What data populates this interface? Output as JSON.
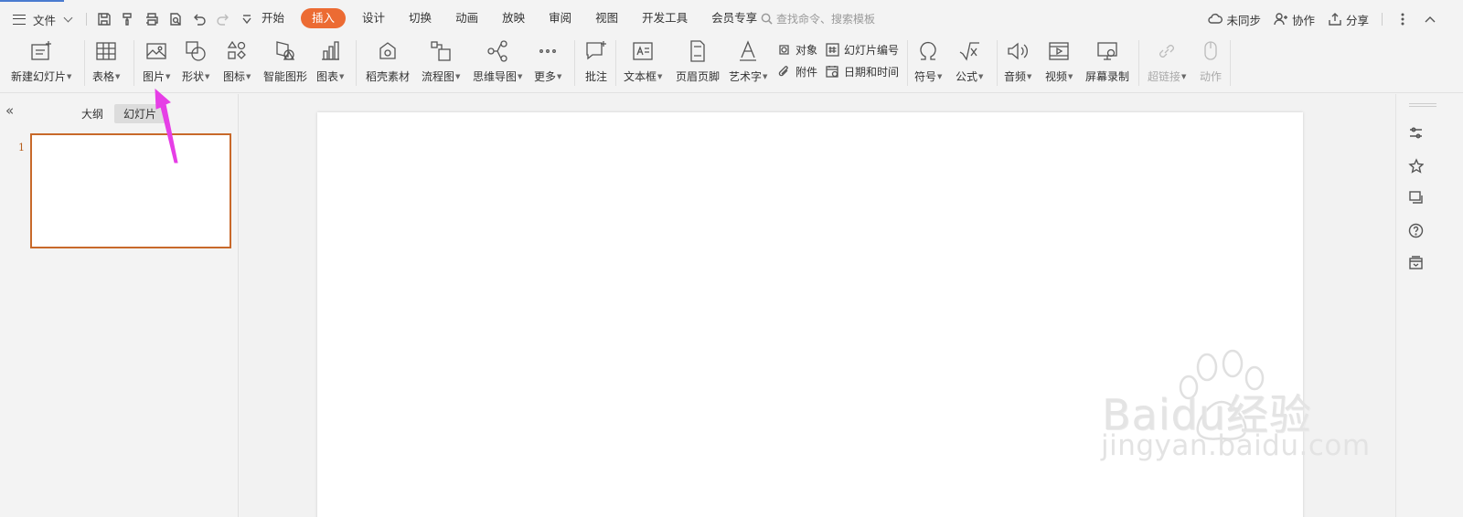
{
  "menu": {
    "file_label": "文件"
  },
  "tabs": [
    {
      "label": "开始"
    },
    {
      "label": "插入"
    },
    {
      "label": "设计"
    },
    {
      "label": "切换"
    },
    {
      "label": "动画"
    },
    {
      "label": "放映"
    },
    {
      "label": "审阅"
    },
    {
      "label": "视图"
    },
    {
      "label": "开发工具"
    },
    {
      "label": "会员专享"
    }
  ],
  "active_tab_color": "#ec6b33",
  "search": {
    "placeholder": "查找命令、搜索模板"
  },
  "right_actions": {
    "sync": "未同步",
    "collab": "协作",
    "share": "分享"
  },
  "ribbon": {
    "new_slide": "新建幻灯片",
    "table": "表格",
    "picture": "图片",
    "shape": "形状",
    "icon": "图标",
    "smartart": "智能图形",
    "chart": "图表",
    "daoke": "稻壳素材",
    "flowchart": "流程图",
    "mindmap": "思维导图",
    "more": "更多",
    "comment": "批注",
    "textbox": "文本框",
    "header_footer": "页眉页脚",
    "wordart": "艺术字",
    "object": "对象",
    "attachment": "附件",
    "slide_number": "幻灯片编号",
    "datetime": "日期和时间",
    "symbol": "符号",
    "formula": "公式",
    "audio": "音频",
    "video": "视频",
    "screen_record": "屏幕录制",
    "hyperlink": "超链接",
    "action": "动作"
  },
  "left_panel": {
    "outline_tab": "大纲",
    "slides_tab": "幻灯片",
    "slide_number": "1"
  },
  "thumbnail_border_color": "#c8692a",
  "watermark": {
    "brand": "Baidu经验",
    "url": "jingyan.baidu.com"
  }
}
